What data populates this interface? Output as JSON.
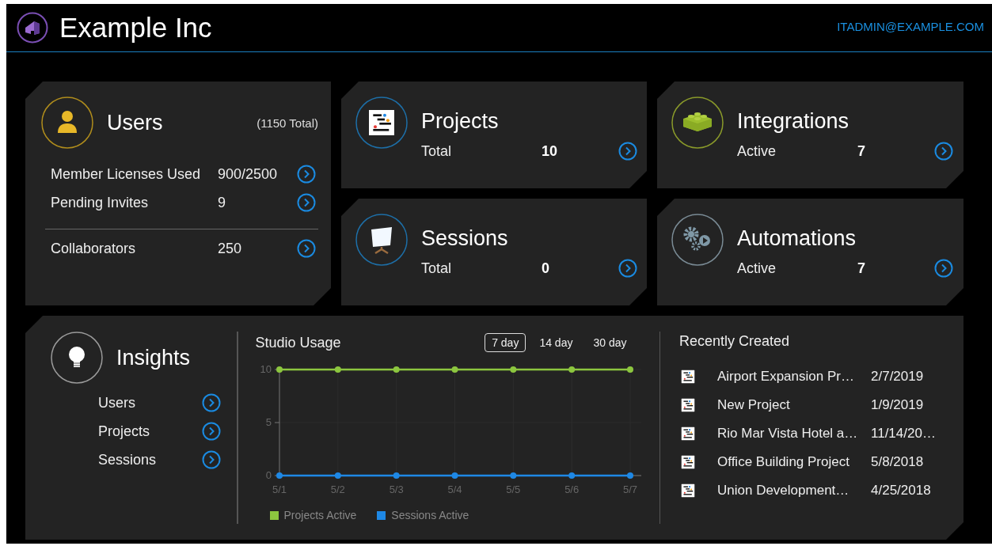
{
  "header": {
    "company": "Example Inc",
    "user_email": "ITADMIN@EXAMPLE.COM"
  },
  "users_card": {
    "title": "Users",
    "total": "(1150 Total)",
    "rows": [
      {
        "label": "Member Licenses Used",
        "value": "900/2500"
      },
      {
        "label": "Pending Invites",
        "value": "9"
      }
    ],
    "collaborators": {
      "label": "Collaborators",
      "value": "250"
    }
  },
  "stat_cards": [
    {
      "kind": "projects",
      "title": "Projects",
      "label": "Total",
      "value": "10"
    },
    {
      "kind": "integrations",
      "title": "Integrations",
      "label": "Active",
      "value": "7"
    },
    {
      "kind": "sessions",
      "title": "Sessions",
      "label": "Total",
      "value": "0"
    },
    {
      "kind": "automations",
      "title": "Automations",
      "label": "Active",
      "value": "7"
    }
  ],
  "insights": {
    "title": "Insights",
    "links": [
      "Users",
      "Projects",
      "Sessions"
    ]
  },
  "studio_usage": {
    "title": "Studio Usage",
    "ranges": [
      {
        "label": "7 day",
        "selected": true
      },
      {
        "label": "14 day",
        "selected": false
      },
      {
        "label": "30 day",
        "selected": false
      }
    ],
    "chart_data": {
      "type": "line",
      "categories": [
        "5/1",
        "5/2",
        "5/3",
        "5/4",
        "5/5",
        "5/6",
        "5/7"
      ],
      "ylim": [
        0,
        10
      ],
      "yticks": [
        0,
        5,
        10
      ],
      "grid": true,
      "series": [
        {
          "name": "Projects Active",
          "color": "#8cc63f",
          "marker": true,
          "values": [
            10,
            10,
            10,
            10,
            10,
            10,
            10
          ]
        },
        {
          "name": "Sessions Active",
          "color": "#1e88e5",
          "marker": true,
          "values": [
            0,
            0,
            0,
            0,
            0,
            0,
            0
          ]
        }
      ]
    }
  },
  "recently_created": {
    "title": "Recently Created",
    "items": [
      {
        "name": "Airport Expansion Pr…",
        "date": "2/7/2019"
      },
      {
        "name": "New Project",
        "date": "1/9/2019"
      },
      {
        "name": "Rio Mar Vista Hotel a…",
        "date": "11/14/20…"
      },
      {
        "name": "Office Building Project",
        "date": "5/8/2018"
      },
      {
        "name": "Union Development…",
        "date": "4/25/2018"
      }
    ]
  }
}
